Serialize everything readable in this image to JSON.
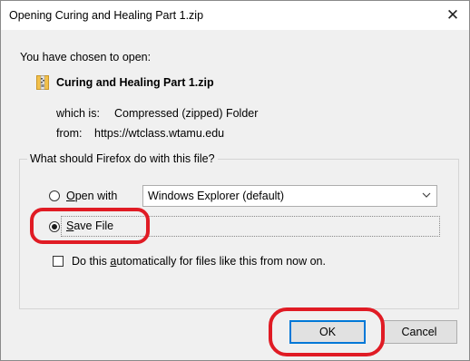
{
  "window": {
    "title": "Opening Curing and Healing Part 1.zip",
    "close_glyph": "✕"
  },
  "intro": "You have chosen to open:",
  "file": {
    "icon": "zip-folder-icon",
    "name": "Curing and Healing Part 1.zip",
    "type_label": "which is:",
    "type_value": "Compressed (zipped) Folder",
    "from_label": "from:",
    "from_value": "https://wtclass.wtamu.edu"
  },
  "group": {
    "legend": "What should Firefox do with this file?",
    "open_with": {
      "label_access": "O",
      "label_rest": "pen with",
      "selected": false
    },
    "app_select": {
      "value": "Windows Explorer (default)"
    },
    "save_file": {
      "label_access": "S",
      "label_rest": "ave File",
      "selected": true
    },
    "auto": {
      "label_before": "Do this ",
      "label_access": "a",
      "label_after": "utomatically for files like this from now on.",
      "checked": false
    }
  },
  "buttons": {
    "ok": "OK",
    "cancel": "Cancel"
  },
  "colors": {
    "annotation": "#e01b24",
    "focus_border": "#0078d7",
    "dialog_bg": "#f0f0f0"
  }
}
